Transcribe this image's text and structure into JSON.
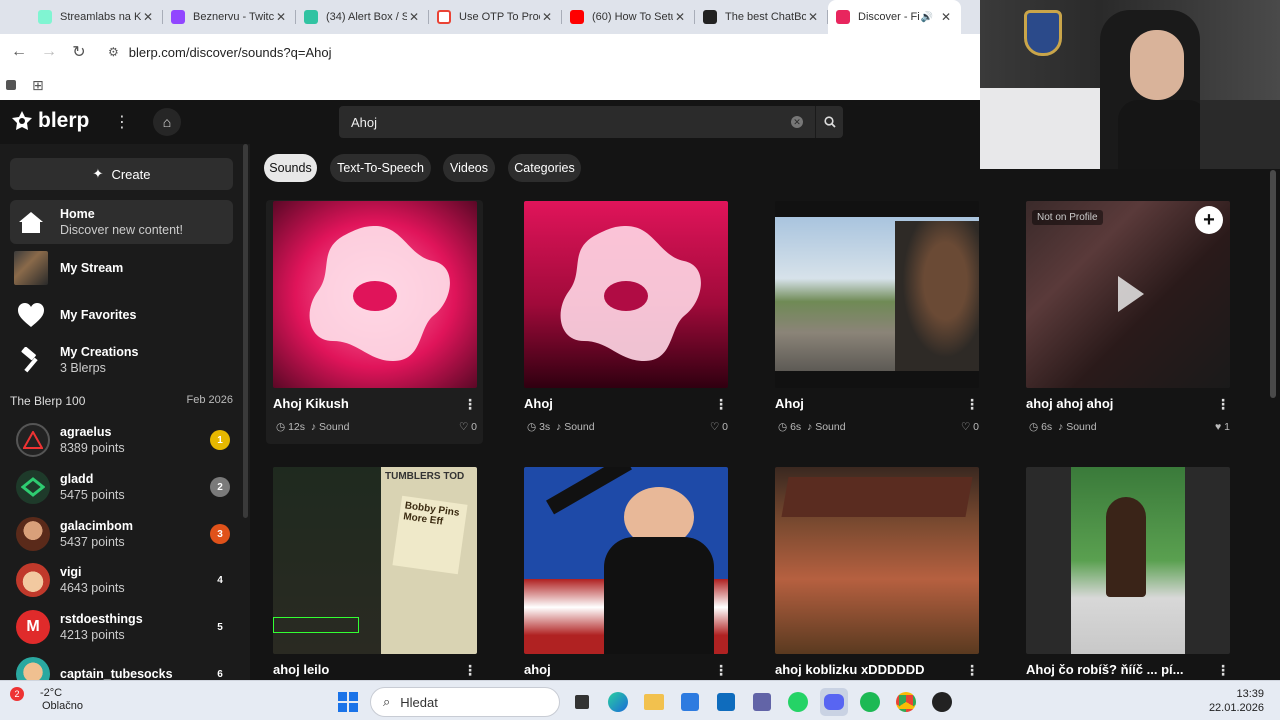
{
  "browser": {
    "tabs": [
      {
        "title": "Streamlabs na Ki",
        "color": "#80f5d2"
      },
      {
        "title": "Beznervu - Twitc",
        "color": "#9146ff"
      },
      {
        "title": "(34) Alert Box / S",
        "color": "#31c3a2"
      },
      {
        "title": "Use OTP To Proc",
        "color": "#ea4335"
      },
      {
        "title": "(60) How To Setu",
        "color": "#ff0000"
      },
      {
        "title": "The best ChatBo",
        "color": "#222222"
      },
      {
        "title": "Discover - Fi",
        "color": "#e8265e",
        "active": true
      }
    ],
    "url": "blerp.com/discover/sounds?q=Ahoj"
  },
  "app": {
    "logo_text": "blerp",
    "search_value": "Ahoj",
    "create_label": "Create",
    "nav": [
      {
        "label": "Home",
        "sub": "Discover new content!",
        "icon": "home-icon"
      },
      {
        "label": "My Stream",
        "sub": "",
        "icon": "stream-thumbnail"
      },
      {
        "label": "My Favorites",
        "sub": "",
        "icon": "heart-icon"
      },
      {
        "label": "My Creations",
        "sub": "3 Blerps",
        "icon": "hammer-icon"
      }
    ],
    "blerp100": {
      "title": "The Blerp 100",
      "date": "Feb 2026"
    },
    "leaderboard": [
      {
        "name": "agraelus",
        "points": "8389 points",
        "rank": "1",
        "rank_color": "#e6b800"
      },
      {
        "name": "gladd",
        "points": "5475 points",
        "rank": "2",
        "rank_color": "#7a7a7a"
      },
      {
        "name": "galacimbom",
        "points": "5437 points",
        "rank": "3",
        "rank_color": "#e0521a"
      },
      {
        "name": "vigi",
        "points": "4643 points",
        "rank": "4",
        "rank_color": "transparent"
      },
      {
        "name": "rstdoesthings",
        "points": "4213 points",
        "rank": "5",
        "rank_color": "transparent"
      },
      {
        "name": "captain_tubesocks",
        "points": "",
        "rank": "6",
        "rank_color": "transparent"
      }
    ],
    "filters": [
      "Sounds",
      "Text-To-Speech",
      "Videos",
      "Categories"
    ],
    "active_filter": "Sounds",
    "cards_row1": [
      {
        "title": "Ahoj Kikush",
        "duration": "12s",
        "type": "Sound",
        "likes": "0"
      },
      {
        "title": "Ahoj",
        "duration": "3s",
        "type": "Sound",
        "likes": "0"
      },
      {
        "title": "Ahoj",
        "duration": "6s",
        "type": "Sound",
        "likes": "0"
      },
      {
        "title": "ahoj ahoj ahoj",
        "duration": "6s",
        "type": "Sound",
        "likes": "1"
      }
    ],
    "cards_row2": [
      {
        "title": "ahoj leilo"
      },
      {
        "title": "ahoj"
      },
      {
        "title": "ahoj koblizku xDDDDDD"
      },
      {
        "title": "Ahoj čo robíš? ňííč ... pí..."
      }
    ],
    "overlay": {
      "not_on_profile": "Not on Profile"
    },
    "thumb_texts": {
      "tumblers": "TUMBLERS TOD",
      "bobby": "Bobby Pins",
      "more": "More Eff"
    }
  },
  "taskbar": {
    "temperature": "-2°C",
    "weather": "Oblačno",
    "weather_badge": "2",
    "search_placeholder": "Hledat",
    "time": "13:39",
    "date": "22.01.2026"
  }
}
